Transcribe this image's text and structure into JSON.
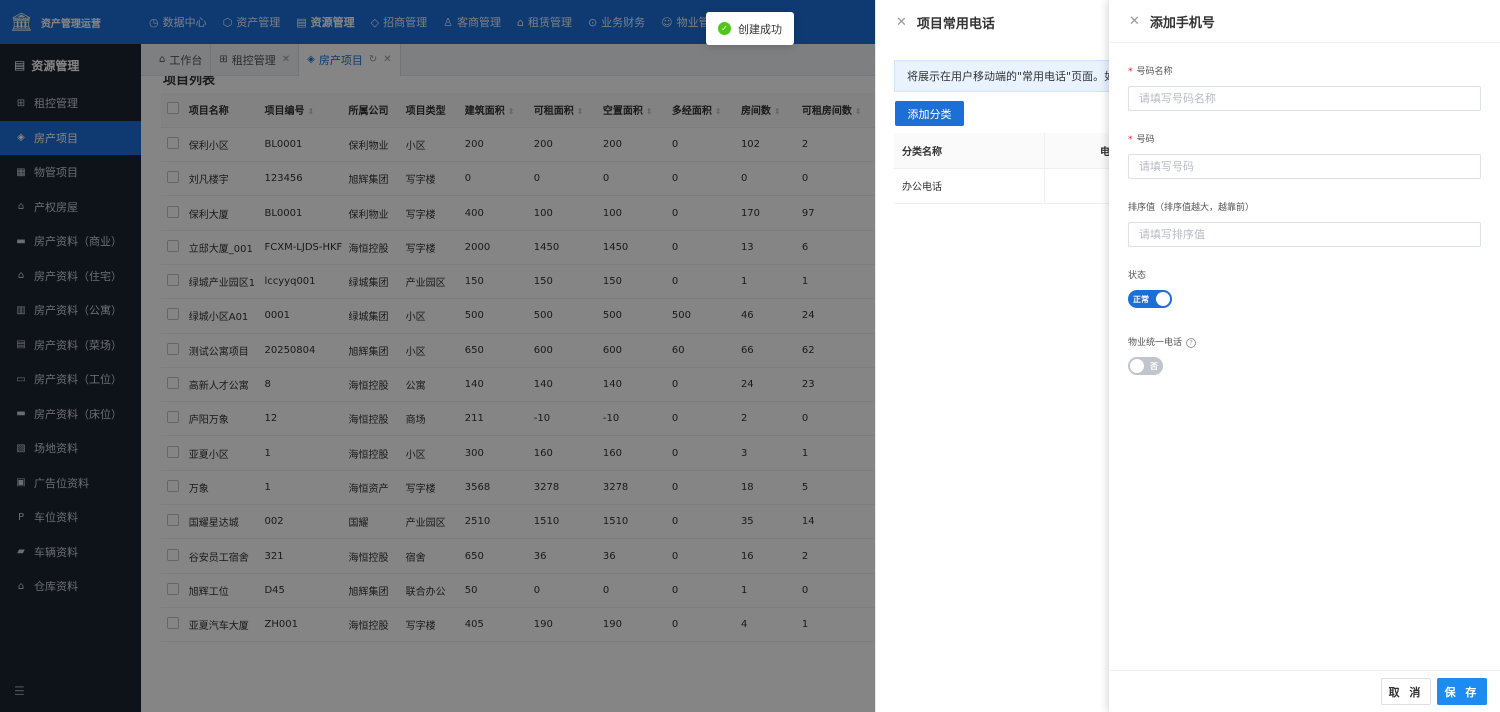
{
  "header": {
    "logo_text": "资产管理运营",
    "logo_icon": "bank-icon",
    "nav": [
      {
        "label": "数据中心",
        "icon": "dashboard-icon"
      },
      {
        "label": "资产管理",
        "icon": "cube-icon"
      },
      {
        "label": "资源管理",
        "icon": "building-icon",
        "active": true
      },
      {
        "label": "招商管理",
        "icon": "tag-icon"
      },
      {
        "label": "客商管理",
        "icon": "users-icon"
      },
      {
        "label": "租赁管理",
        "icon": "house-icon"
      },
      {
        "label": "业务财务",
        "icon": "finance-icon"
      },
      {
        "label": "物业管理",
        "icon": "service-icon"
      }
    ]
  },
  "sidebar": {
    "title": "资源管理",
    "items": [
      {
        "label": "租控管理",
        "icon": "grid-icon"
      },
      {
        "label": "房产项目",
        "icon": "layers-icon",
        "active": true
      },
      {
        "label": "物管项目",
        "icon": "office-icon"
      },
      {
        "label": "产权房屋",
        "icon": "home-icon"
      },
      {
        "label": "房产资料（商业）",
        "icon": "shop-icon"
      },
      {
        "label": "房产资料（住宅）",
        "icon": "house-icon"
      },
      {
        "label": "房产资料（公寓）",
        "icon": "apartment-icon"
      },
      {
        "label": "房产资料（菜场）",
        "icon": "market-icon"
      },
      {
        "label": "房产资料（工位）",
        "icon": "desk-icon"
      },
      {
        "label": "房产资料（床位）",
        "icon": "bed-icon"
      },
      {
        "label": "场地资料",
        "icon": "field-icon"
      },
      {
        "label": "广告位资料",
        "icon": "billboard-icon"
      },
      {
        "label": "车位资料",
        "icon": "parking-icon"
      },
      {
        "label": "车辆资料",
        "icon": "car-icon"
      },
      {
        "label": "仓库资料",
        "icon": "warehouse-icon"
      }
    ]
  },
  "tabs": [
    {
      "label": "工作台",
      "icon": "home-icon",
      "closable": false
    },
    {
      "label": "租控管理",
      "icon": "grid-icon",
      "closable": true
    },
    {
      "label": "房产项目",
      "icon": "layers-icon",
      "closable": true,
      "active": true
    }
  ],
  "main": {
    "section_title": "项目列表",
    "columns": [
      "项目名称",
      "项目编号",
      "所属公司",
      "项目类型",
      "建筑面积",
      "可租面积",
      "空置面积",
      "多经面积",
      "房间数",
      "可租房间数"
    ],
    "rows": [
      [
        "保利小区",
        "BL0001",
        "保利物业",
        "小区",
        "200",
        "200",
        "200",
        "0",
        "102",
        "2"
      ],
      [
        "刘凡楼宇",
        "123456",
        "旭辉集团",
        "写字楼",
        "0",
        "0",
        "0",
        "0",
        "0",
        "0"
      ],
      [
        "保利大厦",
        "BL0001",
        "保利物业",
        "写字楼",
        "400",
        "100",
        "100",
        "0",
        "170",
        "97"
      ],
      [
        "立邸大厦_001",
        "FCXM-LJDS-HKF",
        "海恒控股",
        "写字楼",
        "2000",
        "1450",
        "1450",
        "0",
        "13",
        "6"
      ],
      [
        "绿城产业园区1",
        "lccyyq001",
        "绿城集团",
        "产业园区",
        "150",
        "150",
        "150",
        "0",
        "1",
        "1"
      ],
      [
        "绿城小区A01",
        "0001",
        "绿城集团",
        "小区",
        "500",
        "500",
        "500",
        "500",
        "46",
        "24"
      ],
      [
        "测试公寓项目",
        "20250804",
        "旭辉集团",
        "小区",
        "650",
        "600",
        "600",
        "60",
        "66",
        "62"
      ],
      [
        "高新人才公寓",
        "8",
        "海恒控股",
        "公寓",
        "140",
        "140",
        "140",
        "0",
        "24",
        "23"
      ],
      [
        "庐阳万象",
        "12",
        "海恒控股",
        "商场",
        "211",
        "-10",
        "-10",
        "0",
        "2",
        "0"
      ],
      [
        "亚夏小区",
        "1",
        "海恒控股",
        "小区",
        "300",
        "160",
        "160",
        "0",
        "3",
        "1"
      ],
      [
        "万象",
        "1",
        "海恒资产",
        "写字楼",
        "3568",
        "3278",
        "3278",
        "0",
        "18",
        "5"
      ],
      [
        "国耀星达城",
        "002",
        "国耀",
        "产业园区",
        "2510",
        "1510",
        "1510",
        "0",
        "35",
        "14"
      ],
      [
        "谷安员工宿舍",
        "321",
        "海恒控股",
        "宿舍",
        "650",
        "36",
        "36",
        "0",
        "16",
        "2"
      ],
      [
        "旭辉工位",
        "D45",
        "旭辉集团",
        "联合办公",
        "50",
        "0",
        "0",
        "0",
        "1",
        "0"
      ],
      [
        "亚夏汽车大厦",
        "ZH001",
        "海恒控股",
        "写字楼",
        "405",
        "190",
        "190",
        "0",
        "4",
        "1"
      ]
    ]
  },
  "drawer_phones": {
    "title": "项目常用电话",
    "note": "将展示在用户移动端的\"常用电话\"页面。如",
    "add_button": "添加分类",
    "columns": [
      "分类名称",
      "电"
    ],
    "rows": [
      [
        "办公电话",
        ""
      ]
    ]
  },
  "drawer_add": {
    "title": "添加手机号",
    "fields": {
      "name_label": "号码名称",
      "name_placeholder": "请填写号码名称",
      "number_label": "号码",
      "number_placeholder": "请填写号码",
      "sort_label": "排序值（排序值越大，越靠前）",
      "sort_placeholder": "请填写排序值",
      "status_label": "状态",
      "status_value": "正常",
      "unified_label": "物业统一电话",
      "unified_value": "否"
    },
    "cancel_label": "取 消",
    "save_label": "保 存"
  },
  "toast": {
    "text": "创建成功"
  },
  "colors": {
    "primary": "#1d6fd8",
    "sidebar_bg": "#1c2330",
    "success": "#52c41a",
    "required": "#f5222d"
  }
}
